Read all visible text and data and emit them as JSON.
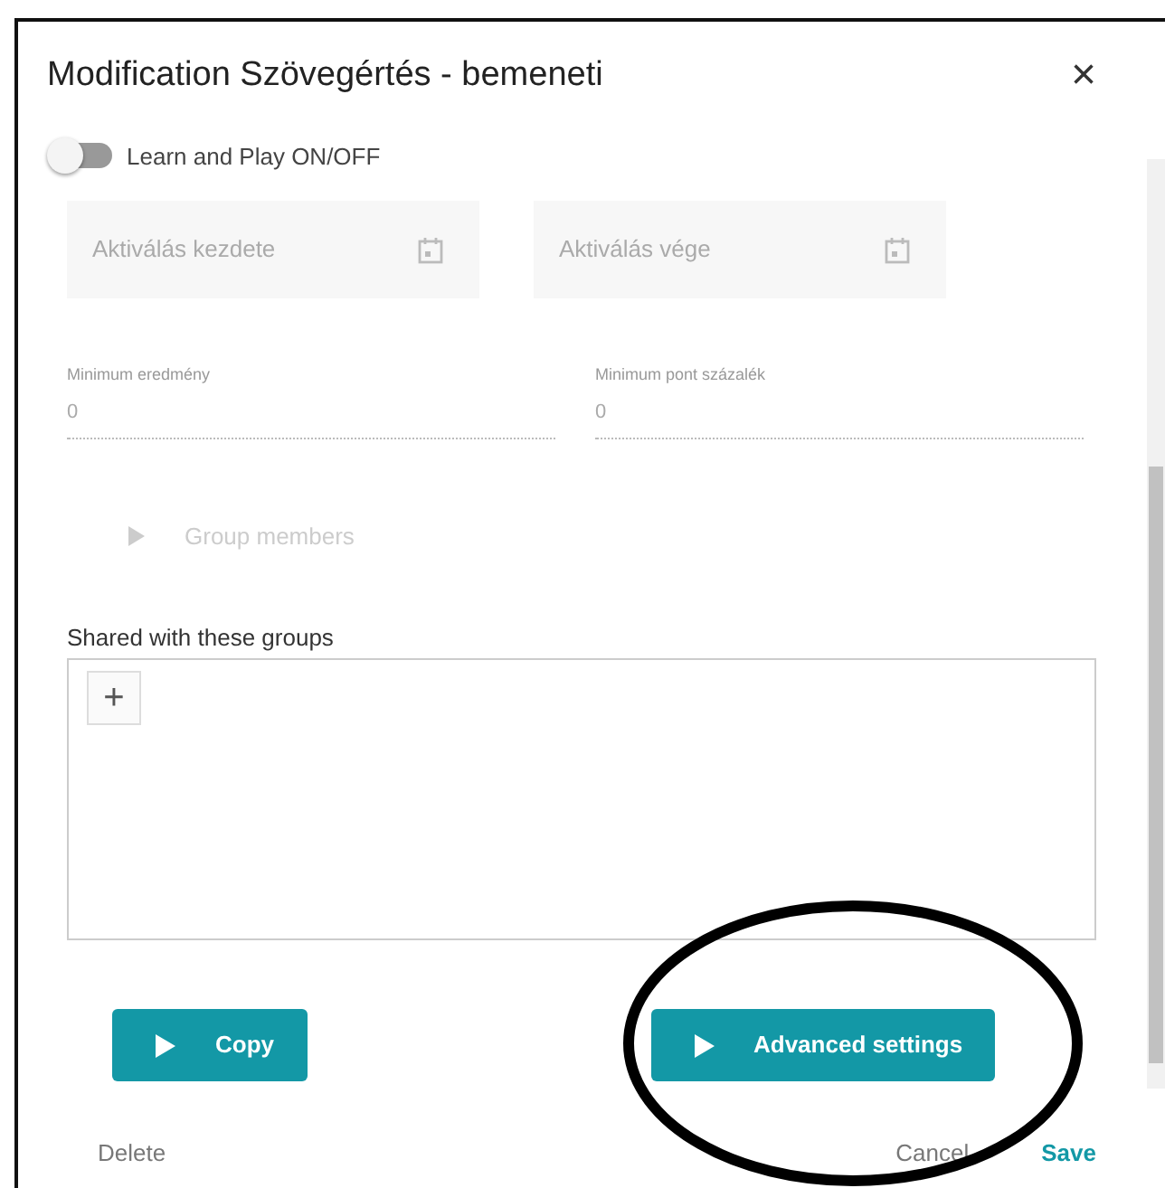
{
  "dialog": {
    "title": "Modification Szövegértés - bemeneti",
    "close": "×"
  },
  "toggle": {
    "label": "Learn and Play ON/OFF",
    "on": false
  },
  "date_fields": [
    {
      "placeholder": "Aktiválás kezdete"
    },
    {
      "placeholder": "Aktiválás vége"
    }
  ],
  "number_fields": [
    {
      "label": "Minimum eredmény",
      "value": "0"
    },
    {
      "label": "Minimum pont százalék",
      "value": "0"
    }
  ],
  "group_members": {
    "label": "Group members",
    "disabled": true
  },
  "shared_groups": {
    "label": "Shared with these groups",
    "add": "+"
  },
  "action_buttons": [
    {
      "label": "Copy"
    },
    {
      "label": "Advanced settings"
    }
  ],
  "footer": {
    "delete": "Delete",
    "cancel": "Cancel",
    "save": "Save"
  }
}
